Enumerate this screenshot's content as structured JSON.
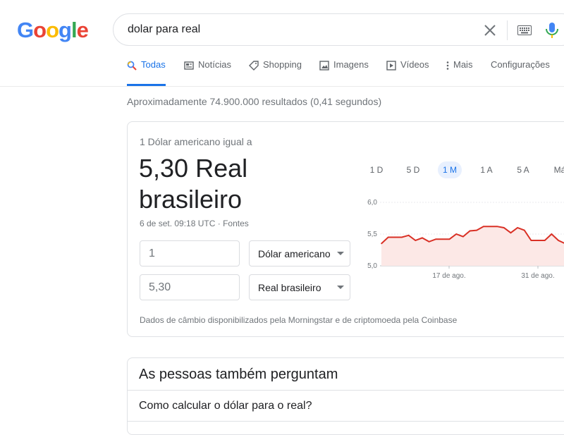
{
  "logo": {
    "text": "Google"
  },
  "search": {
    "query": "dolar para real"
  },
  "tabs": [
    {
      "label": "Todas",
      "icon": "search-icon"
    },
    {
      "label": "Notícias",
      "icon": "news-icon"
    },
    {
      "label": "Shopping",
      "icon": "tag-icon"
    },
    {
      "label": "Imagens",
      "icon": "image-icon"
    },
    {
      "label": "Vídeos",
      "icon": "video-icon"
    },
    {
      "label": "Mais",
      "icon": "more-vert-icon"
    },
    {
      "label": "Configurações",
      "icon": ""
    }
  ],
  "result_stats": "Aproximadamente 74.900.000 resultados (0,41 segundos)",
  "converter": {
    "label": "1 Dólar americano igual a",
    "value_line1": "5,30 Real",
    "value_line2": "brasileiro",
    "timestamp": "6 de set. 09:18 UTC",
    "separator": " · ",
    "sources_link": "Fontes",
    "from_amount": "1",
    "from_currency": "Dólar americano",
    "to_amount": "5,30",
    "to_currency": "Real brasileiro",
    "data_source": "Dados de câmbio disponibilizados pela Morningstar e de criptomoeda pela Coinbase",
    "ranges": [
      "1 D",
      "5 D",
      "1 M",
      "1 A",
      "5 A",
      "Má"
    ],
    "active_range": "1 M"
  },
  "chart_data": {
    "type": "area",
    "y_ticks": [
      "6,0",
      "5,5",
      "5,0"
    ],
    "x_ticks": [
      "17 de ago.",
      "31 de ago."
    ],
    "ylim": [
      5.0,
      6.0
    ],
    "values": [
      5.35,
      5.45,
      5.45,
      5.45,
      5.48,
      5.4,
      5.44,
      5.38,
      5.42,
      5.42,
      5.42,
      5.5,
      5.46,
      5.55,
      5.56,
      5.62,
      5.62,
      5.62,
      5.6,
      5.52,
      5.6,
      5.56,
      5.4,
      5.4,
      5.4,
      5.5,
      5.4,
      5.35,
      5.3,
      5.31
    ],
    "line_color": "#d93025",
    "fill_color": "#fce8e6"
  },
  "paa": {
    "title": "As pessoas também perguntam",
    "questions": [
      "Como calcular o dólar para o real?"
    ]
  }
}
